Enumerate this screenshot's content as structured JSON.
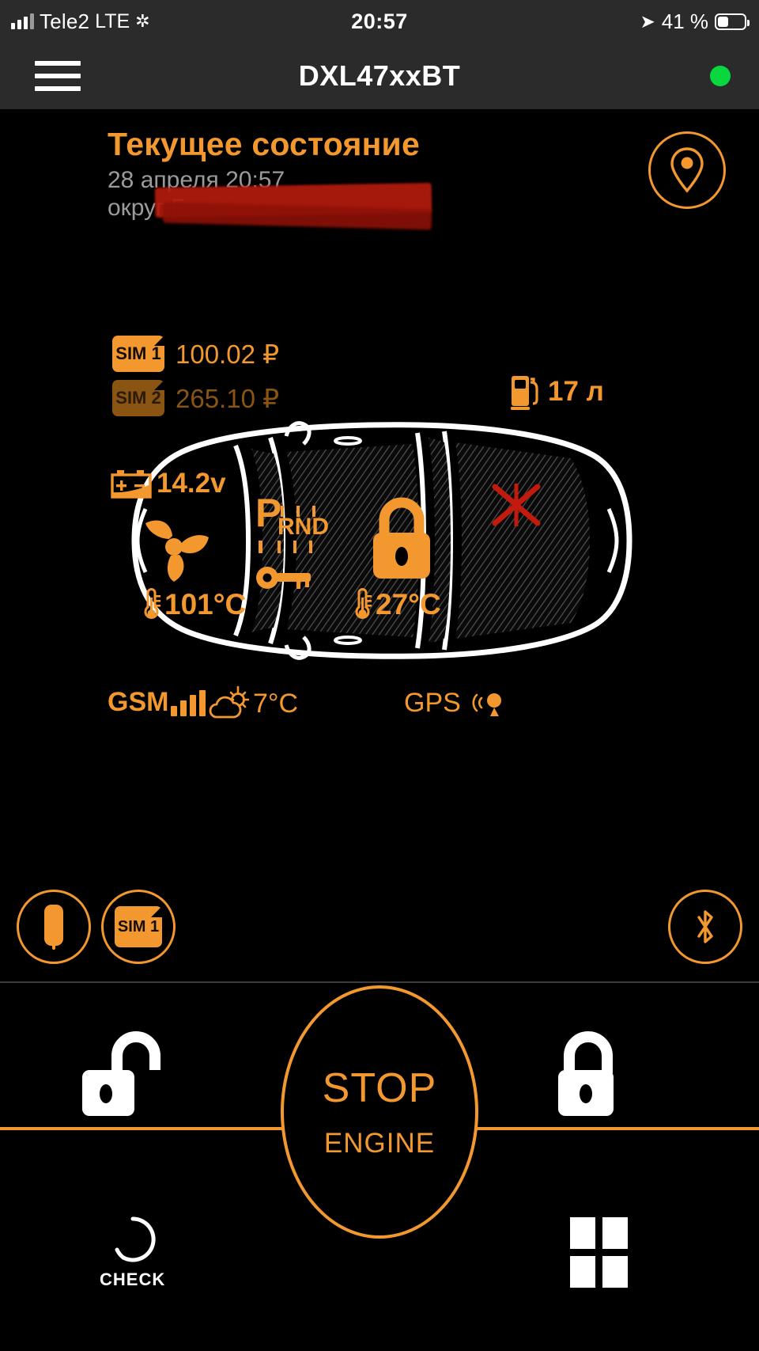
{
  "status_bar": {
    "carrier": "Tele2",
    "network": "LTE",
    "sync_icon": "sync-spinner-icon",
    "time": "20:57",
    "location_icon": "location-arrow-icon",
    "battery_percent": "41 %",
    "battery_icon": "battery-icon"
  },
  "app_bar": {
    "menu_icon": "hamburger-menu-icon",
    "title": "DXL47xxBT",
    "connection_dot_color": "#07d83f"
  },
  "header": {
    "title": "Текущее состояние",
    "datetime": "28 апреля 20:57",
    "location": "округ Г",
    "location_redacted": true,
    "map_pin_icon": "map-pin-icon"
  },
  "sims": [
    {
      "label": "SIM 1",
      "balance": "100.02 ₽",
      "active": true
    },
    {
      "label": "SIM 2",
      "balance": "265.10 ₽",
      "active": false
    }
  ],
  "fuel": {
    "icon": "fuel-pump-icon",
    "value": "17 л"
  },
  "car": {
    "battery": {
      "icon": "car-battery-icon",
      "value": "14.2v"
    },
    "fan": {
      "icon": "turbine-fan-icon"
    },
    "engine_temp": {
      "icon": "thermometer-icon",
      "value": "101°C"
    },
    "gearbox": {
      "icon": "gear-selector-icon",
      "selected": "P",
      "positions": "RND"
    },
    "ignition": {
      "icon": "key-icon"
    },
    "doors": {
      "icon": "padlock-closed-icon",
      "state": "locked"
    },
    "cabin_temp": {
      "icon": "thermometer-icon",
      "value": "27°C"
    },
    "alarm_zone": {
      "icon": "cross-x-icon",
      "color": "#c21a0c"
    }
  },
  "status_row": {
    "gsm": {
      "label": "GSM",
      "icon": "signal-bars-icon",
      "bars": 4
    },
    "weather": {
      "icon": "sun-cloud-icon",
      "value": "7°C"
    },
    "gps": {
      "label": "GPS",
      "icon": "satellite-signal-icon"
    }
  },
  "quick_actions": [
    {
      "name": "key-fob",
      "icon": "key-fob-icon",
      "label": ""
    },
    {
      "name": "sim-select",
      "icon": "sim-card-icon",
      "label": "SIM 1"
    },
    {
      "name": "bluetooth",
      "icon": "bluetooth-icon",
      "label": ""
    }
  ],
  "controls": {
    "unlock": {
      "icon": "padlock-open-icon"
    },
    "lock": {
      "icon": "padlock-closed-icon"
    },
    "engine": {
      "line1": "STOP",
      "line2": "ENGINE"
    },
    "check": {
      "icon": "check-circle-icon",
      "label": "CHECK"
    },
    "more": {
      "icon": "grid-squares-icon"
    }
  },
  "colors": {
    "accent": "#f2982f",
    "accent_dim": "#8a5413",
    "background": "#000000",
    "bar": "#2b2b2b",
    "connected": "#07d83f",
    "redaction": "#b21a0d"
  }
}
